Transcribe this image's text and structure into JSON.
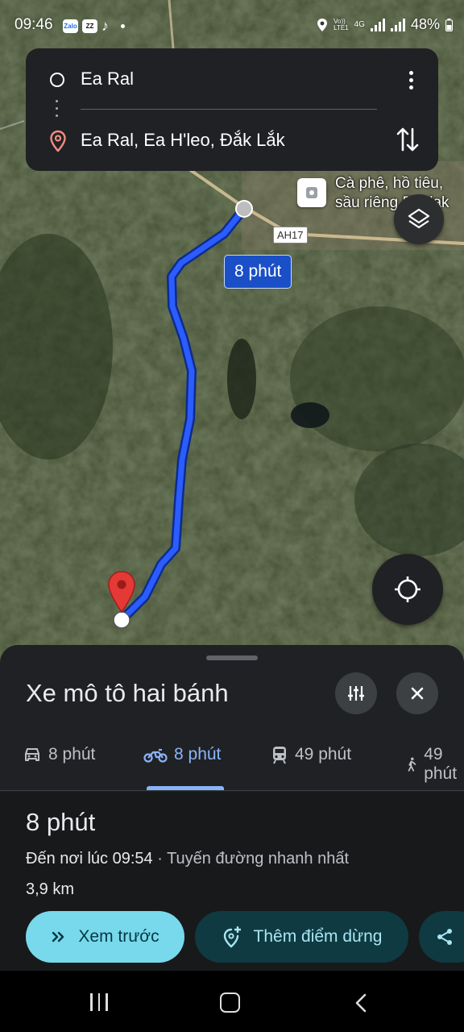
{
  "status_bar": {
    "time": "09:46",
    "app_icons": [
      "Zalo",
      "ZZ",
      "♪"
    ],
    "network_top": "Vo))",
    "network_bottom": "LTE1",
    "net_type": "4G",
    "battery": "48%"
  },
  "search": {
    "origin": "Ea Ral",
    "destination": "Ea Ral, Ea H'leo, Đắk Lắk",
    "icons": [
      "origin-circle-icon",
      "more-vert-icon",
      "location-pin-icon",
      "swap-icon"
    ]
  },
  "map": {
    "poi_label_line1": "Cà phê, hồ tiêu,",
    "poi_label_line2": "sầu riêng Daklak",
    "road_label": "AH17",
    "route_duration": "8 phút",
    "route_color": "#1f4bff",
    "pin_color": "#e53935"
  },
  "sheet": {
    "title": "Xe mô tô hai bánh",
    "tabs": [
      {
        "icon": "car-icon",
        "label": "8 phút"
      },
      {
        "icon": "motorbike-icon",
        "label": "8 phút"
      },
      {
        "icon": "transit-icon",
        "label": "49 phút"
      },
      {
        "icon": "walk-icon",
        "label": "49 phút"
      }
    ],
    "active_tab": 1,
    "route": {
      "duration": "8 phút",
      "arrival": "Đến nơi lúc 09:54",
      "separator": " · ",
      "note": "Tuyến đường nhanh nhất",
      "distance": "3,9 km"
    },
    "buttons": {
      "preview": "Xem trước",
      "add_stop": "Thêm điểm dừng"
    }
  },
  "colors": {
    "accent": "#8ab4f8",
    "preview_button": "#78d9ec",
    "sheet_bg": "#202124"
  }
}
